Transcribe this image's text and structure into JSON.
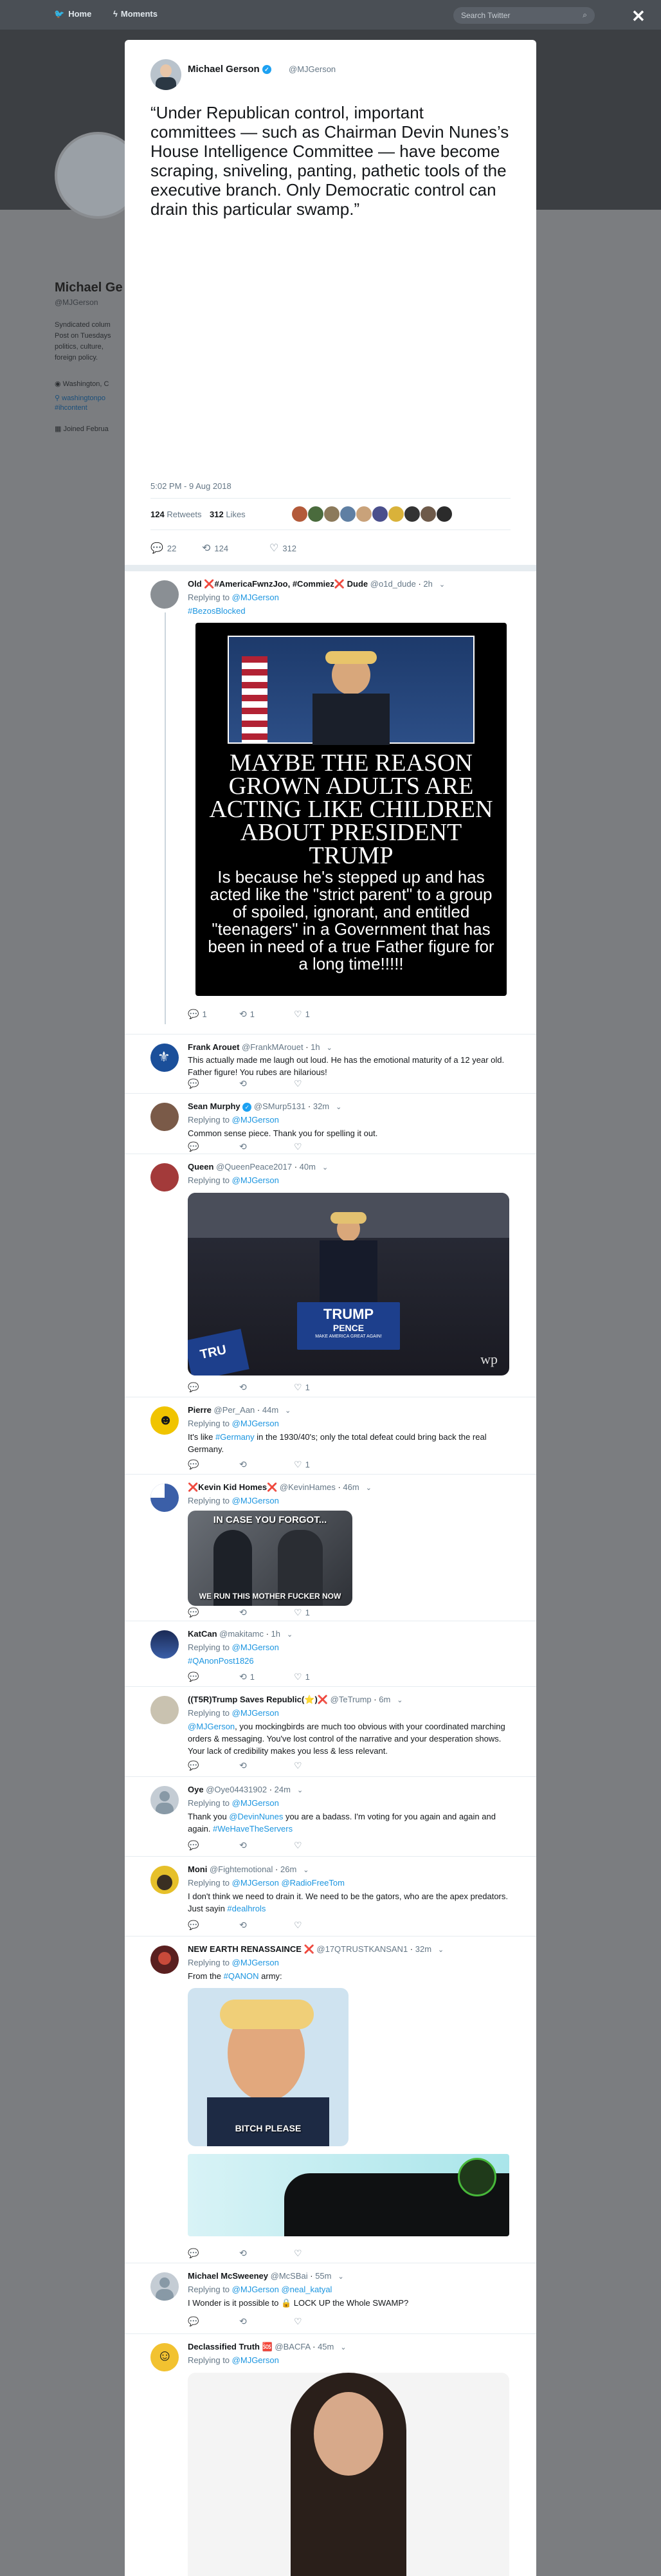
{
  "nav": {
    "home_label": "Home",
    "moments_label": "Moments",
    "search_placeholder": "Search Twitter",
    "close_icon": "close-icon",
    "close_glyph": "✕"
  },
  "profile": {
    "name": "Michael Ge",
    "handle": "@MJGerson",
    "bio": "Syndicated colum Post on Tuesdays politics, culture, foreign policy.",
    "location": "Washington, C",
    "link": "washingtonpo",
    "link2": "#ihcontent",
    "joined": "Joined Februa"
  },
  "tweet": {
    "author_name": "Michael Gerson",
    "author_handle": "@MJGerson",
    "text": "“Under Republican control, important committees — such as Chairman Devin Nunes’s House Intelligence Committee — have become scraping, sniveling, panting, pathetic tools of the executive branch. Only Democratic control can drain this particular swamp.”",
    "timestamp": "5:02 PM - 9 Aug 2018",
    "retweets_count": "124",
    "retweets_label": "Retweets",
    "likes_count": "312",
    "likes_label": "Likes",
    "replies": "22",
    "retweets_action": "124",
    "likes_action": "312",
    "liker_colors": [
      "#b35a3a",
      "#4a6b3d",
      "#8c7a5b",
      "#5f7fa3",
      "#c9a27a",
      "#4a4f8c",
      "#d9b23a",
      "#333333",
      "#6e5a4a",
      "#2b2b2b"
    ]
  },
  "replies": [
    {
      "name": "Old ❌#AmericaFwnzJoo, #Commiez❌ Dude",
      "handle": "@o1d_dude",
      "time": "2h",
      "replying_prefix": "Replying to",
      "replying_to": "@MJGerson",
      "text_link": "#BezosBlocked",
      "meme_top": "MAYBE THE REASON GROWN ADULTS ARE ACTING LIKE CHILDREN ABOUT PRESIDENT TRUMP",
      "meme_bottom": "Is because he's stepped up and has acted like the \"strict parent\" to a group of spoiled, ignorant, and entitled \"teenagers\" in a Government that has been in need of a true Father figure for a long time!!!!!",
      "reply_count": "1",
      "retweet_count": "1",
      "like_count": "1"
    },
    {
      "name": "Frank Arouet",
      "handle": "@FrankMArouet",
      "time": "1h",
      "text": "This actually made me laugh out loud. He has the emotional maturity of a 12 year old. Father figure! You rubes are hilarious!",
      "reply_count": "",
      "retweet_count": "",
      "like_count": ""
    },
    {
      "name": "Sean Murphy",
      "handle": "@SMurp5131",
      "time": "32m",
      "replying_prefix": "Replying to",
      "replying_to": "@MJGerson",
      "text": "Common sense piece. Thank you for spelling it out.",
      "reply_count": "",
      "retweet_count": "",
      "like_count": ""
    },
    {
      "name": "Queen",
      "handle": "@QueenPeace2017",
      "time": "40m",
      "replying_prefix": "Replying to",
      "replying_to": "@MJGerson",
      "sign_top": "TRUMP",
      "sign_bottom": "PENCE",
      "sign_small": "MAKE AMERICA GREAT AGAIN!",
      "sign_side": "TRU",
      "watermark": "wp",
      "reply_count": "",
      "retweet_count": "",
      "like_count": "1"
    },
    {
      "name": "Pierre",
      "handle": "@Per_Aan",
      "time": "44m",
      "replying_prefix": "Replying to",
      "replying_to": "@MJGerson",
      "text_a": "It's like ",
      "text_link": "#Germany",
      "text_b": " in the 1930/40's; only the total defeat could bring back the real Germany.",
      "reply_count": "",
      "retweet_count": "",
      "like_count": "1"
    },
    {
      "name": "❌Kevin Kid Homes❌",
      "handle": "@KevinHames",
      "time": "46m",
      "replying_prefix": "Replying to",
      "replying_to": "@MJGerson",
      "meme_top": "IN CASE YOU FORGOT...",
      "meme_bottom": "WE RUN THIS MOTHER FUCKER NOW",
      "reply_count": "",
      "retweet_count": "",
      "like_count": "1"
    },
    {
      "name": "KatCan",
      "handle": "@makitamc",
      "time": "1h",
      "replying_prefix": "Replying to",
      "replying_to": "@MJGerson",
      "text_link": "#QAnonPost1826",
      "reply_count": "",
      "retweet_count": "1",
      "like_count": "1"
    },
    {
      "name": "((T5R)Trump Saves Republic(⭐)❌",
      "handle": "@TeTrump",
      "time": "6m",
      "replying_prefix": "Replying to",
      "replying_to": "@MJGerson",
      "text_link": "@MJGerson",
      "text": ", you mockingbirds are much too obvious with your coordinated marching orders & messaging. You've lost control of the narrative and your desperation shows. Your lack of credibility makes you less & less relevant.",
      "reply_count": "",
      "retweet_count": "",
      "like_count": ""
    },
    {
      "name": "Oye",
      "handle": "@Oye04431902",
      "time": "24m",
      "replying_prefix": "Replying to",
      "replying_to": "@MJGerson",
      "text_a": "Thank you ",
      "text_link": "@DevinNunes",
      "text_b": " you are a badass. I'm voting for you again and again and again. ",
      "text_link2": "#WeHaveTheServers",
      "reply_count": "",
      "retweet_count": "",
      "like_count": ""
    },
    {
      "name": "Moni",
      "handle": "@Fightemotional",
      "time": "26m",
      "replying_prefix": "Replying to",
      "replying_to": "@MJGerson",
      "replying_and": "@RadioFreeTom",
      "text_a": "I don't think we need to drain it. We need to be the gators, who are the apex predators. Just sayin ",
      "text_link": "#dealhrols",
      "reply_count": "",
      "retweet_count": "",
      "like_count": ""
    },
    {
      "name": "NEW EARTH RENASSAINCE ❌",
      "handle": "@17QTRUSTKANSAN1",
      "time": "32m",
      "replying_prefix": "Replying to",
      "replying_to": "@MJGerson",
      "text_a": "From the ",
      "text_link": "#QANON",
      "text_b": " army:",
      "meme_caption": "BITCH PLEASE",
      "reply_count": "",
      "retweet_count": "",
      "like_count": ""
    },
    {
      "name": "Michael McSweeney",
      "handle": "@McSBai",
      "time": "55m",
      "replying_prefix": "Replying to",
      "replying_to": "@MJGerson",
      "replying_and": "@neal_katyal",
      "text": "I Wonder is it possible to 🔒 LOCK UP the Whole SWAMP?",
      "reply_count": "",
      "retweet_count": "",
      "like_count": ""
    },
    {
      "name": "Declassified Truth 🆘",
      "handle": "@BACFA",
      "time": "45m",
      "replying_prefix": "Replying to",
      "replying_to": "@MJGerson"
    }
  ]
}
